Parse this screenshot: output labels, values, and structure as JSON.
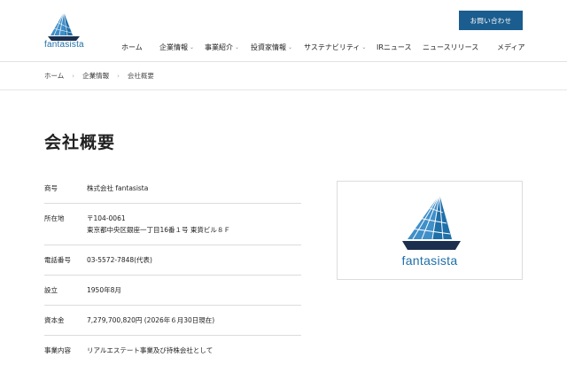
{
  "header": {
    "brand": "fantasista",
    "contact_label": "お問い合わせ",
    "nav": [
      {
        "label": "ホーム",
        "dropdown": false
      },
      {
        "label": "企業情報",
        "dropdown": true
      },
      {
        "label": "事業紹介",
        "dropdown": true
      },
      {
        "label": "投資家情報",
        "dropdown": true
      },
      {
        "label": "サステナビリティ",
        "dropdown": true
      },
      {
        "label": "IRニュース",
        "dropdown": false
      },
      {
        "label": "ニュースリリース",
        "dropdown": false
      },
      {
        "label": "メディア",
        "dropdown": false
      }
    ],
    "dropdown_glyph": "⌄"
  },
  "breadcrumb": {
    "items": [
      "ホーム",
      "企業情報",
      "会社概要"
    ],
    "separator": "›"
  },
  "page": {
    "title": "会社概要"
  },
  "company_info": [
    {
      "label": "商号",
      "lines": [
        "株式会社 fantasista"
      ]
    },
    {
      "label": "所在地",
      "lines": [
        "〒104-0061",
        "東京都中央区銀座一丁目16番１号 東貨ビル８Ｆ"
      ]
    },
    {
      "label": "電話番号",
      "lines": [
        "03-5572-7848(代表)"
      ]
    },
    {
      "label": "設立",
      "lines": [
        "1950年8月"
      ]
    },
    {
      "label": "資本金",
      "lines": [
        "7,279,700,820円 (2026年６月30日現在)"
      ]
    },
    {
      "label": "事業内容",
      "lines": [
        "リアルエステート事業及び持株会社として"
      ]
    }
  ],
  "logo_panel": {
    "brand": "fantasista"
  },
  "colors": {
    "brand_blue": "#1f6fa9",
    "sail_light": "#3f8fc9",
    "hull_dark": "#1c2f4f",
    "button_bg": "#1b5d8e"
  },
  "icons": {
    "logo": "sailboat-logo-icon",
    "dropdown": "chevron-down-icon",
    "breadcrumb_separator": "chevron-right-icon"
  }
}
